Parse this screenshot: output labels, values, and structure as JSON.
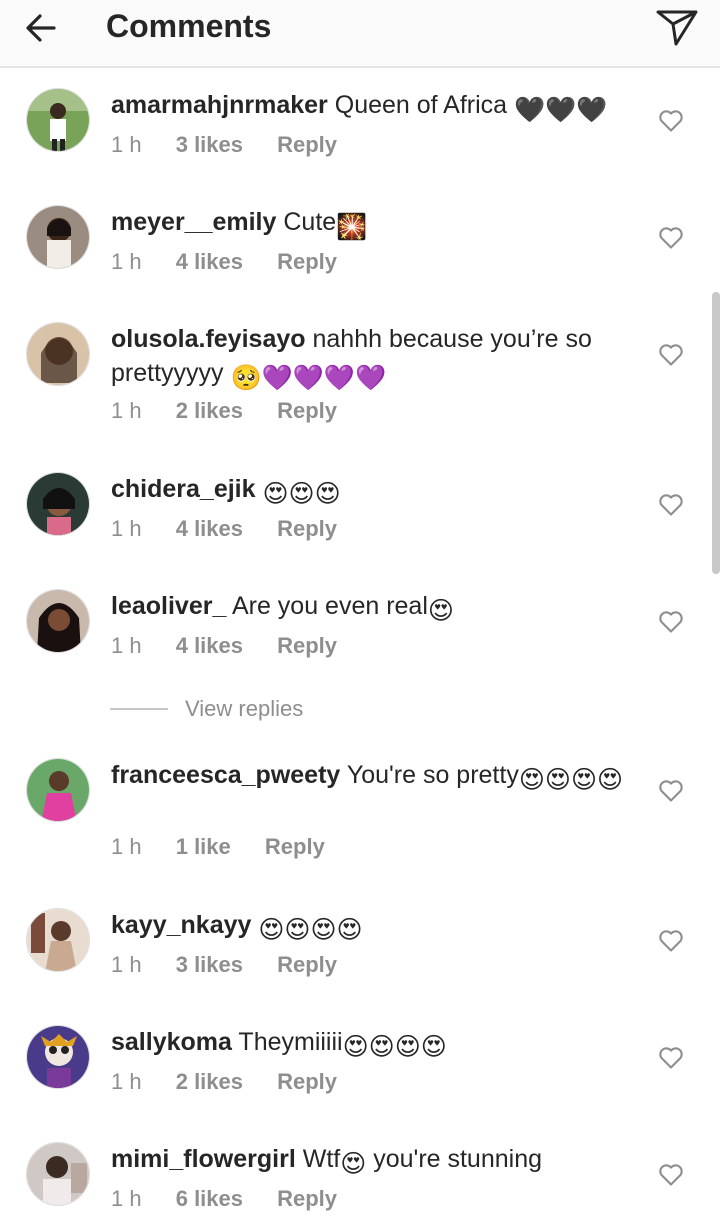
{
  "header": {
    "title": "Comments",
    "back_icon": "arrow-left-icon",
    "send_icon": "paper-plane-icon"
  },
  "view_replies_label": "View replies",
  "colors": {
    "text": "#262626",
    "muted": "#8e8e8e",
    "header_bg": "#fafafa",
    "divider": "#e6e6e6"
  },
  "comments": [
    {
      "username": "amarmahjnrmaker",
      "text": "Queen of Africa",
      "emoji": "🖤🖤🖤",
      "time": "1 h",
      "likes": "3 likes",
      "reply": "Reply"
    },
    {
      "username": "meyer__emily",
      "text": "Cute",
      "emoji": "🎇",
      "time": "1 h",
      "likes": "4 likes",
      "reply": "Reply"
    },
    {
      "username": "olusola.feyisayo",
      "text": "nahhh because you’re so prettyyyyy",
      "emoji": "🥺💜💜💜💜",
      "time": "1 h",
      "likes": "2 likes",
      "reply": "Reply"
    },
    {
      "username": "chidera_ejik",
      "text": "",
      "emoji": "😍😍😍",
      "time": "1 h",
      "likes": "4 likes",
      "reply": "Reply"
    },
    {
      "username": "leaoliver_",
      "text": "Are you even real",
      "emoji": "😍",
      "time": "1 h",
      "likes": "4 likes",
      "reply": "Reply"
    },
    {
      "username": "franceesca_pweety",
      "text": "You're so pretty",
      "emoji": "😍😍😍😍",
      "time": "1 h",
      "likes": "1 like",
      "reply": "Reply"
    },
    {
      "username": "kayy_nkayy",
      "text": "",
      "emoji": "😍😍😍😍",
      "time": "1 h",
      "likes": "3 likes",
      "reply": "Reply"
    },
    {
      "username": "sallykoma",
      "text": "Theymiiiii",
      "emoji": "😍😍😍😍",
      "time": "1 h",
      "likes": "2 likes",
      "reply": "Reply"
    },
    {
      "username": "mimi_flowergirl",
      "text": "Wtf",
      "emoji": "😍",
      "text_after": "you're stunning",
      "time": "1 h",
      "likes": "6 likes",
      "reply": "Reply"
    }
  ]
}
